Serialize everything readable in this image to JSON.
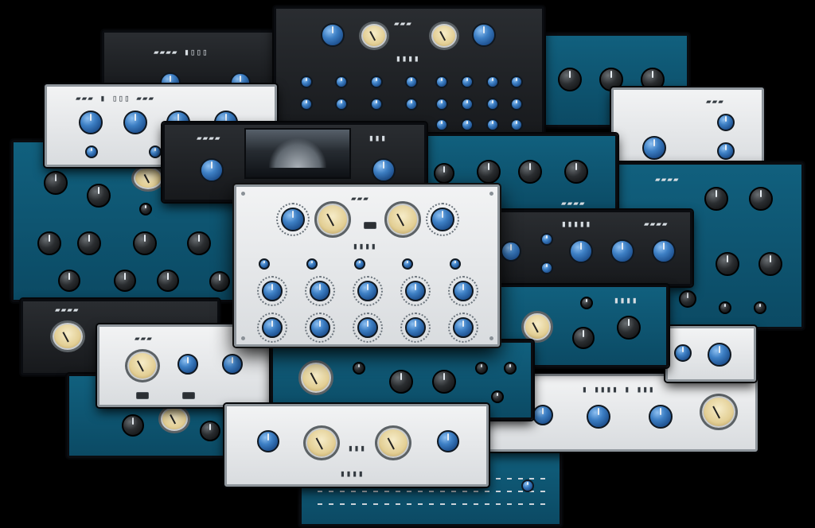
{
  "title": "",
  "colors": {
    "background": "#000000",
    "teal_panel": "#0d5573",
    "dark_panel": "#1f2225",
    "white_panel": "#e6e8ea",
    "knob_blue": "#3d7fc4",
    "meter_face": "#e3cf95"
  },
  "panels": [
    {
      "id": "dark-top-center",
      "style": "dark",
      "label": "",
      "knobs": "blue",
      "meters": 2
    },
    {
      "id": "white-front-center",
      "style": "white",
      "label": "",
      "knobs": "blue",
      "meters": 2
    },
    {
      "id": "dark-hatch",
      "style": "dark",
      "label": "",
      "knobs": "blue",
      "meters": 0
    },
    {
      "id": "teal-left",
      "style": "teal",
      "label": "",
      "knobs": "black",
      "meters": 1
    },
    {
      "id": "teal-right",
      "style": "teal",
      "label": "",
      "knobs": "black",
      "meters": 0
    },
    {
      "id": "white-bottom-center",
      "style": "white",
      "label": "",
      "knobs": "blue",
      "meters": 2
    },
    {
      "id": "white-bottom-right",
      "style": "white",
      "label": "",
      "knobs": "blue",
      "meters": 1
    }
  ],
  "icons": {
    "knob": "knob-icon",
    "meter": "vu-meter-icon",
    "screw": "screw-icon"
  }
}
